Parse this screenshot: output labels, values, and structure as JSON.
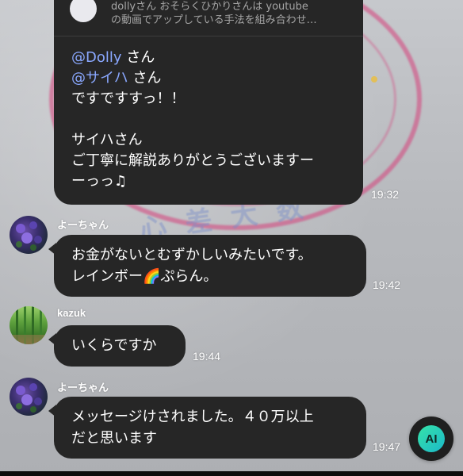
{
  "reply_preview": {
    "line1": "dollyさん おそらくひかりさんは youtube",
    "line2": "の動画でアップしている手法を組み合わせ…"
  },
  "messages": [
    {
      "lines": [
        "@Dolly さん",
        "@サイハ さん",
        "ですですすっ！！",
        "",
        "サイハさん",
        "ご丁寧に解説ありがとうございますー",
        "ーっっ♫"
      ],
      "mention1": "@Dolly",
      "mention1_suffix": " さん",
      "mention2": "@サイハ",
      "mention2_suffix": " さん",
      "time": "19:32"
    },
    {
      "sender": "よーちゃん",
      "line1": "お金がないとむずかしいみたいです。",
      "line2_a": "レインボー",
      "line2_emoji": "🌈",
      "line2_b": "ぷらん。",
      "time": "19:42"
    },
    {
      "sender": "kazuk",
      "text": "いくらですか",
      "time": "19:44"
    },
    {
      "sender": "よーちゃん",
      "line1": "メッセージけされました。４０万以上",
      "line2": "だと思います",
      "time": "19:47"
    }
  ],
  "ai_button": {
    "label": "AI"
  },
  "colors": {
    "bubble": "#262626",
    "mention": "#8aa8ff",
    "ai_gradient_start": "#36e3a8",
    "ai_gradient_end": "#1bb8c9"
  }
}
